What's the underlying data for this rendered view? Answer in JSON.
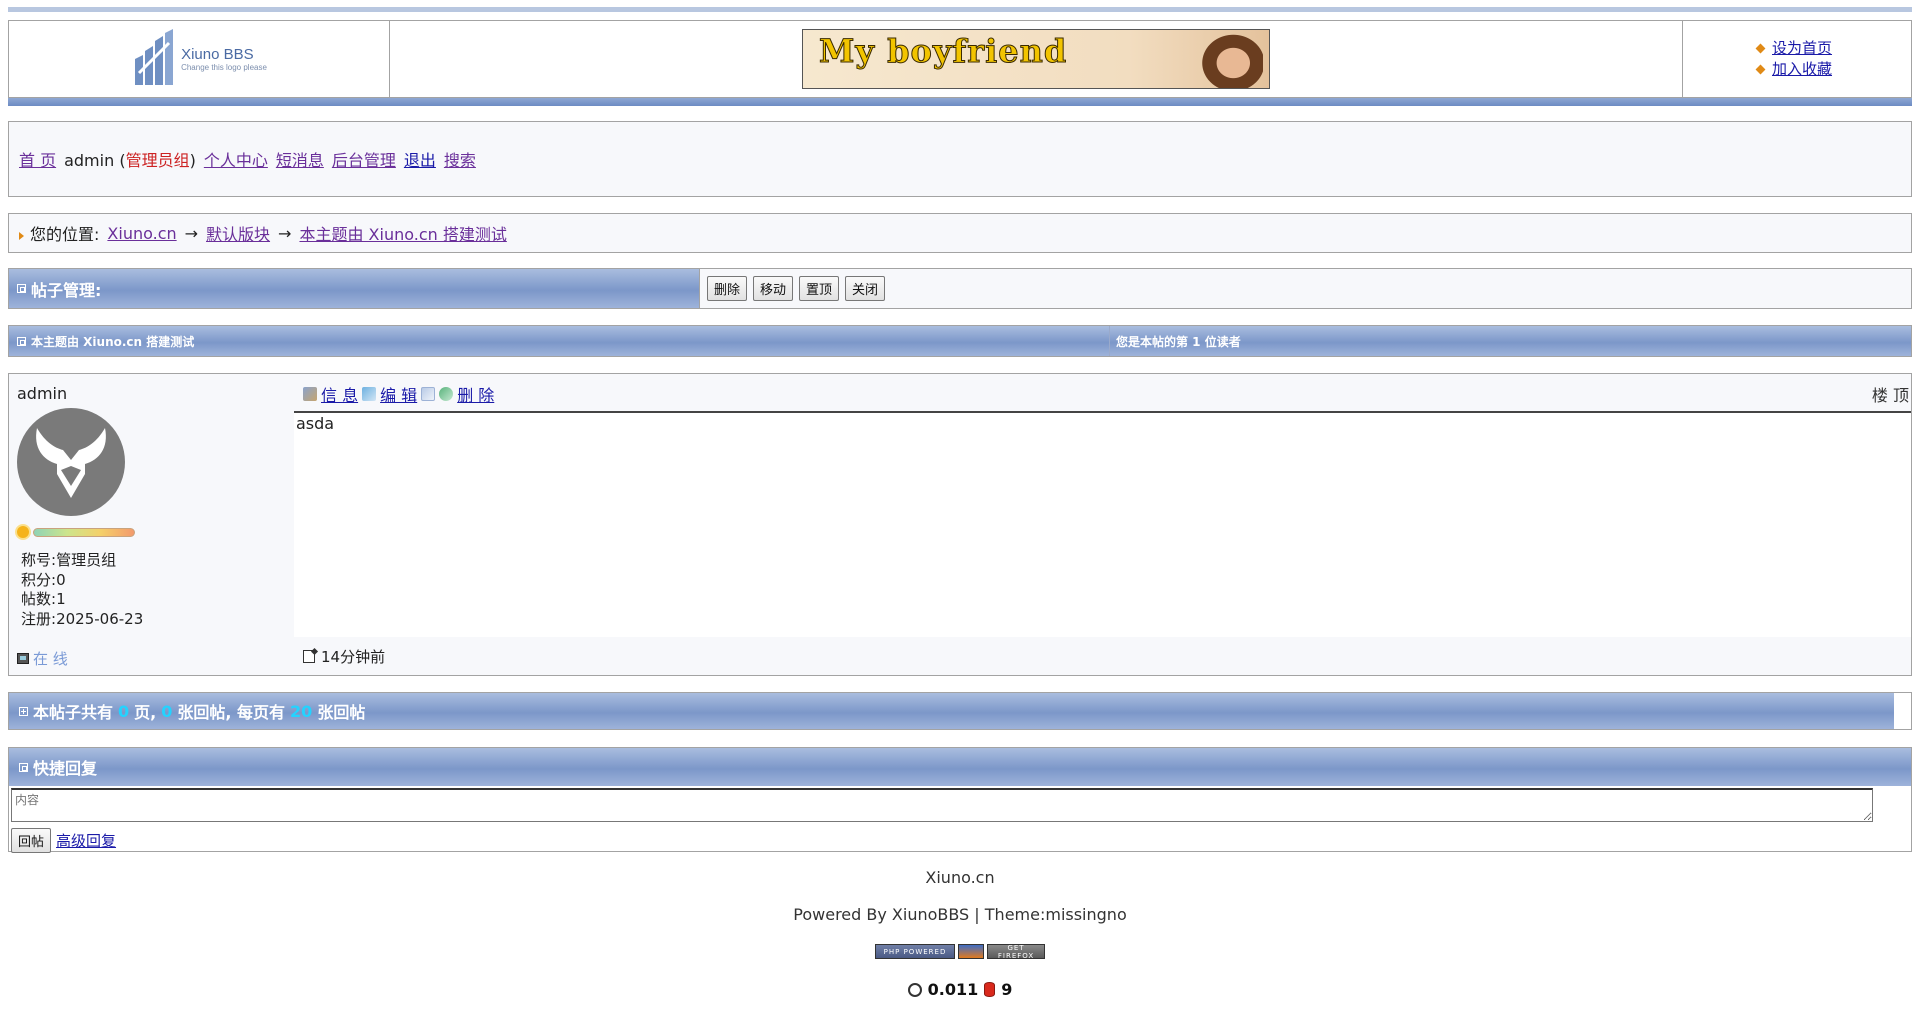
{
  "header": {
    "logo_title": "Xiuno BBS",
    "logo_sub": "Change this logo please",
    "banner_text": "My boyfriend",
    "links": [
      "设为首页",
      "加入收藏"
    ]
  },
  "nav": {
    "home": "首 页",
    "user": "admin",
    "group_open": "(",
    "group": "管理员组",
    "group_close": ")",
    "items": [
      "个人中心",
      "短消息",
      "后台管理",
      "退出",
      "搜索"
    ]
  },
  "breadcrumb": {
    "label": "您的位置:",
    "items": [
      "Xiuno.cn",
      "默认版块",
      "本主题由 Xiuno.cn 搭建测试"
    ],
    "separator": "→"
  },
  "manage": {
    "title": "帖子管理:",
    "buttons": [
      "删除",
      "移动",
      "置顶",
      "关闭"
    ]
  },
  "topic": {
    "left": "本主题由 Xiuno.cn 搭建测试",
    "right": "您是本帖的第 1 位读者"
  },
  "post": {
    "author": "admin",
    "stats": {
      "title_label": "称号:",
      "title": "管理员组",
      "points_label": "积分:",
      "points": "0",
      "posts_label": "帖数:",
      "posts": "1",
      "reg_label": "注册:",
      "reg": "2025-06-23"
    },
    "online": "在 线",
    "actions": [
      "信 息",
      "编 辑",
      "删 除"
    ],
    "floor": "楼 顶",
    "content": "asda",
    "time": "14分钟前"
  },
  "pagination": {
    "p1": "本帖子共有",
    "pages": "0",
    "p2": "页,",
    "replies": "0",
    "p3": "张回帖, 每页有",
    "per_page": "20",
    "p4": "张回帖"
  },
  "quick_reply": {
    "title": "快捷回复",
    "placeholder": "内容",
    "submit": "回帖",
    "advanced": "高级回复"
  },
  "footer": {
    "site": "Xiuno.cn",
    "powered": "Powered By XiunoBBS | Theme:missingno",
    "badges": [
      "PHP POWERED",
      "GET FIREFOX"
    ],
    "time": "0.011",
    "queries": "9"
  }
}
